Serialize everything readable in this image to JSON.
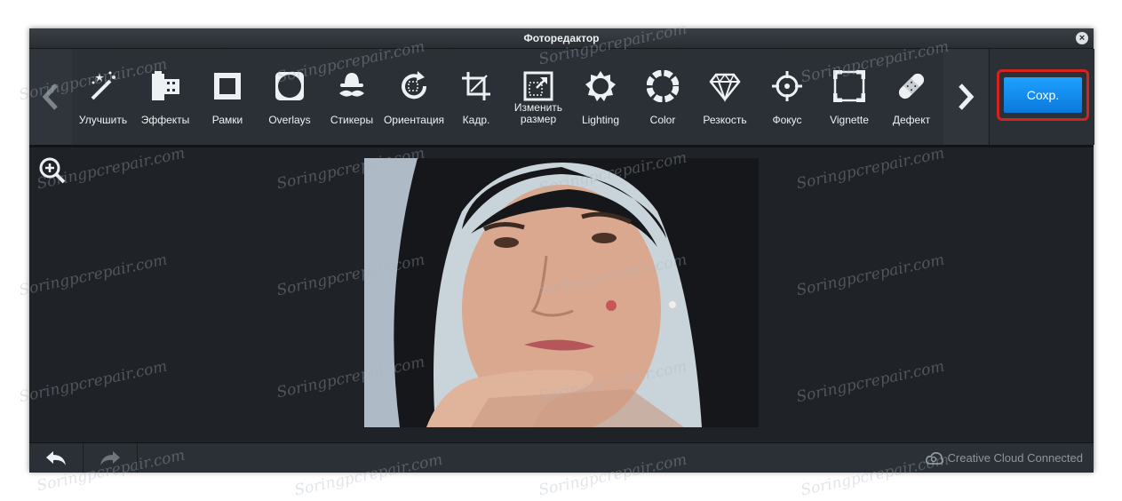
{
  "window": {
    "title": "Фоторедактор",
    "close_icon": "close-icon"
  },
  "toolbar": {
    "prev_icon": "chevron-left-icon",
    "next_icon": "chevron-right-icon",
    "tools": [
      {
        "id": "enhance",
        "label": "Улучшить",
        "icon": "magic-wand-icon"
      },
      {
        "id": "effects",
        "label": "Эффекты",
        "icon": "film-roll-icon"
      },
      {
        "id": "frames",
        "label": "Рамки",
        "icon": "frame-icon"
      },
      {
        "id": "overlays",
        "label": "Overlays",
        "icon": "overlay-icon"
      },
      {
        "id": "stickers",
        "label": "Стикеры",
        "icon": "hat-mustache-icon"
      },
      {
        "id": "orientation",
        "label": "Ориентация",
        "icon": "rotate-icon"
      },
      {
        "id": "crop",
        "label": "Кадр.",
        "icon": "crop-icon"
      },
      {
        "id": "resize",
        "label": "Изменить размер",
        "icon": "resize-icon"
      },
      {
        "id": "lighting",
        "label": "Lighting",
        "icon": "sun-icon"
      },
      {
        "id": "color",
        "label": "Color",
        "icon": "color-ring-icon"
      },
      {
        "id": "sharpness",
        "label": "Резкость",
        "icon": "diamond-icon"
      },
      {
        "id": "focus",
        "label": "Фокус",
        "icon": "crosshair-icon"
      },
      {
        "id": "vignette",
        "label": "Vignette",
        "icon": "vignette-icon"
      },
      {
        "id": "blemish",
        "label": "Дефект",
        "icon": "bandage-icon"
      }
    ],
    "save_label": "Сохр.",
    "colors": {
      "accent": "#1a8ef5",
      "highlight": "#d3231f"
    }
  },
  "canvas": {
    "zoom_icon": "zoom-in-icon"
  },
  "bottom": {
    "undo_icon": "undo-icon",
    "redo_icon": "redo-icon",
    "cc_label": "Creative Cloud Connected",
    "cc_icon": "creative-cloud-icon"
  },
  "watermark": "Soringpcrepair.com"
}
